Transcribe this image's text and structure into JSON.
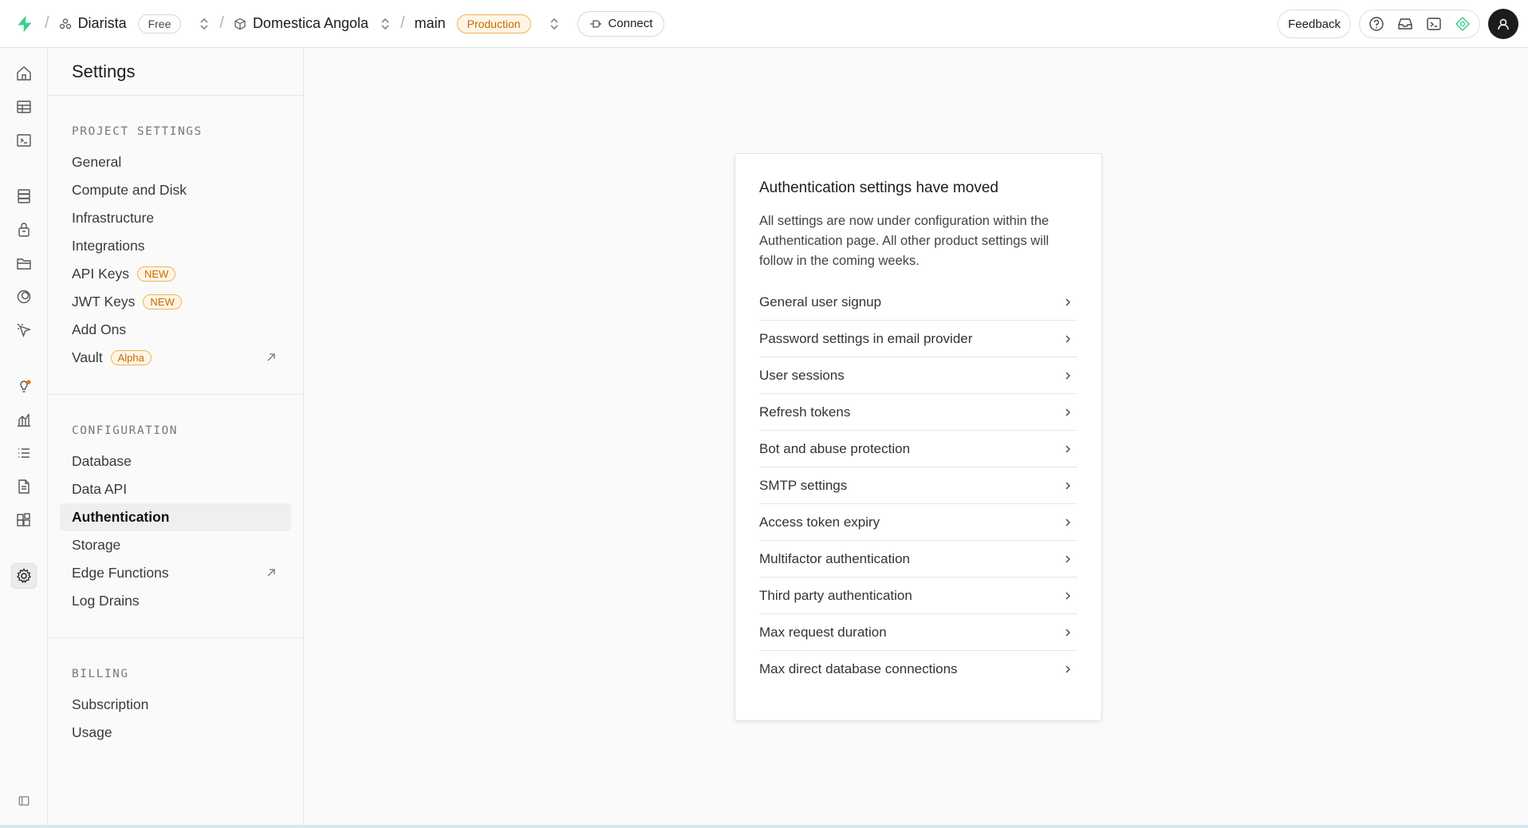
{
  "topbar": {
    "org": "Diarista",
    "plan": "Free",
    "project": "Domestica Angola",
    "branch": "main",
    "env": "Production",
    "connect": "Connect",
    "feedback": "Feedback"
  },
  "panel": {
    "title": "Settings",
    "sections": [
      {
        "title": "PROJECT SETTINGS",
        "items": [
          {
            "label": "General"
          },
          {
            "label": "Compute and Disk"
          },
          {
            "label": "Infrastructure"
          },
          {
            "label": "Integrations"
          },
          {
            "label": "API Keys",
            "badge": "NEW"
          },
          {
            "label": "JWT Keys",
            "badge": "NEW"
          },
          {
            "label": "Add Ons"
          },
          {
            "label": "Vault",
            "badge": "Alpha"
          }
        ]
      },
      {
        "title": "CONFIGURATION",
        "items": [
          {
            "label": "Database"
          },
          {
            "label": "Data API"
          },
          {
            "label": "Authentication"
          },
          {
            "label": "Storage"
          },
          {
            "label": "Edge Functions"
          },
          {
            "label": "Log Drains"
          }
        ]
      },
      {
        "title": "BILLING",
        "items": [
          {
            "label": "Subscription"
          },
          {
            "label": "Usage"
          }
        ]
      }
    ]
  },
  "card": {
    "title": "Authentication settings have moved",
    "description": "All settings are now under configuration within the Authentication page. All other product settings will follow in the coming weeks.",
    "links": [
      "General user signup",
      "Password settings in email provider",
      "User sessions",
      "Refresh tokens",
      "Bot and abuse protection",
      "SMTP settings",
      "Access token expiry",
      "Multifactor authentication",
      "Third party authentication",
      "Max request duration",
      "Max direct database connections"
    ]
  },
  "colors": {
    "brand": "#3ecf8e",
    "accent_orange": "#c66a00"
  }
}
